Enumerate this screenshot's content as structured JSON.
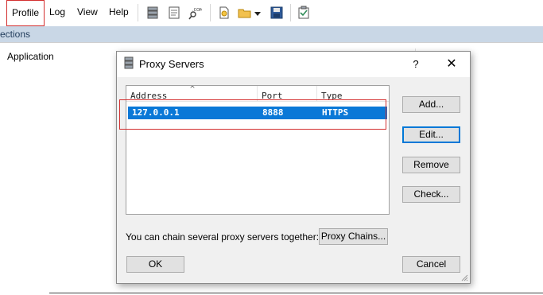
{
  "menu": {
    "items": [
      "Profile",
      "Log",
      "View",
      "Help"
    ]
  },
  "toolbar": {
    "icons": [
      "server-list-icon",
      "notes-icon",
      "dns-com-icon",
      "new-profile-icon",
      "open-folder-icon",
      "dropdown-arrow-icon",
      "save-disk-icon",
      "checklist-icon"
    ]
  },
  "main": {
    "connections_label": "ections",
    "application_header": "Application"
  },
  "dialog": {
    "title": "Proxy Servers",
    "help": "?",
    "close": "✕",
    "columns": [
      "Address",
      "Port",
      "Type"
    ],
    "sort_indicator": "^",
    "rows": [
      {
        "address": "127.0.0.1",
        "port": "8888",
        "type": "HTTPS",
        "selected": true
      }
    ],
    "buttons": {
      "add": "Add...",
      "edit": "Edit...",
      "remove": "Remove",
      "check": "Check...",
      "proxy_chains": "Proxy Chains...",
      "ok": "OK",
      "cancel": "Cancel"
    },
    "chain_text": "You can chain several proxy servers together:"
  },
  "colors": {
    "selection": "#0a78d7",
    "highlight_border": "#d32f2f",
    "strip": "#c9d7e6"
  }
}
